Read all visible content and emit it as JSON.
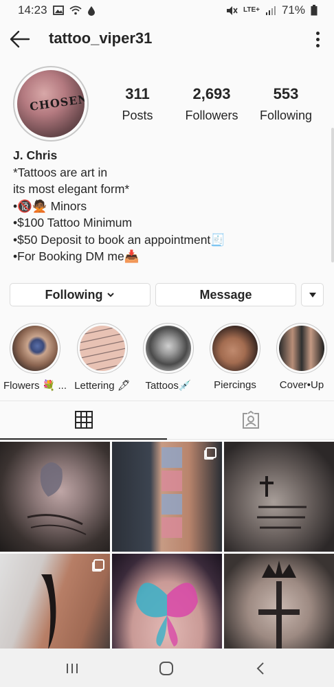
{
  "status_bar": {
    "time": "14:23",
    "network": "LTE+",
    "battery": "71%"
  },
  "header": {
    "username": "tattoo_viper31"
  },
  "avatar": {
    "text": "CHOSEN"
  },
  "stats": [
    {
      "count": "311",
      "label": "Posts"
    },
    {
      "count": "2,693",
      "label": "Followers"
    },
    {
      "count": "553",
      "label": "Following"
    }
  ],
  "bio": {
    "name": "J. Chris",
    "lines": [
      "*Tattoos are art in",
      "its most elegant form*",
      "•🔞🙅🏾 Minors",
      "•$100 Tattoo Minimum",
      "•$50 Deposit to book an appointment🧾",
      "•For Booking DM me📥"
    ]
  },
  "actions": {
    "following": "Following",
    "message": "Message"
  },
  "highlights": [
    {
      "label": "Flowers 💐 ..."
    },
    {
      "label": "Lettering 🖋"
    },
    {
      "label": "Tattoos💉"
    },
    {
      "label": "Piercings"
    },
    {
      "label": "Cover•Up"
    }
  ],
  "tabs": {
    "grid_icon": "grid-icon",
    "tagged_icon": "tagged-icon",
    "active": "grid"
  },
  "posts": [
    {
      "subject": "tulip-script-tattoo",
      "multi": false
    },
    {
      "subject": "chase-blocks-tattoo",
      "multi": true
    },
    {
      "subject": "memorial-cross-tattoo",
      "multi": false
    },
    {
      "subject": "tribal-wrist-tattoo",
      "multi": true
    },
    {
      "subject": "butterfly-tattoo",
      "multi": false
    },
    {
      "subject": "crown-cross-tattoo",
      "multi": false
    }
  ]
}
